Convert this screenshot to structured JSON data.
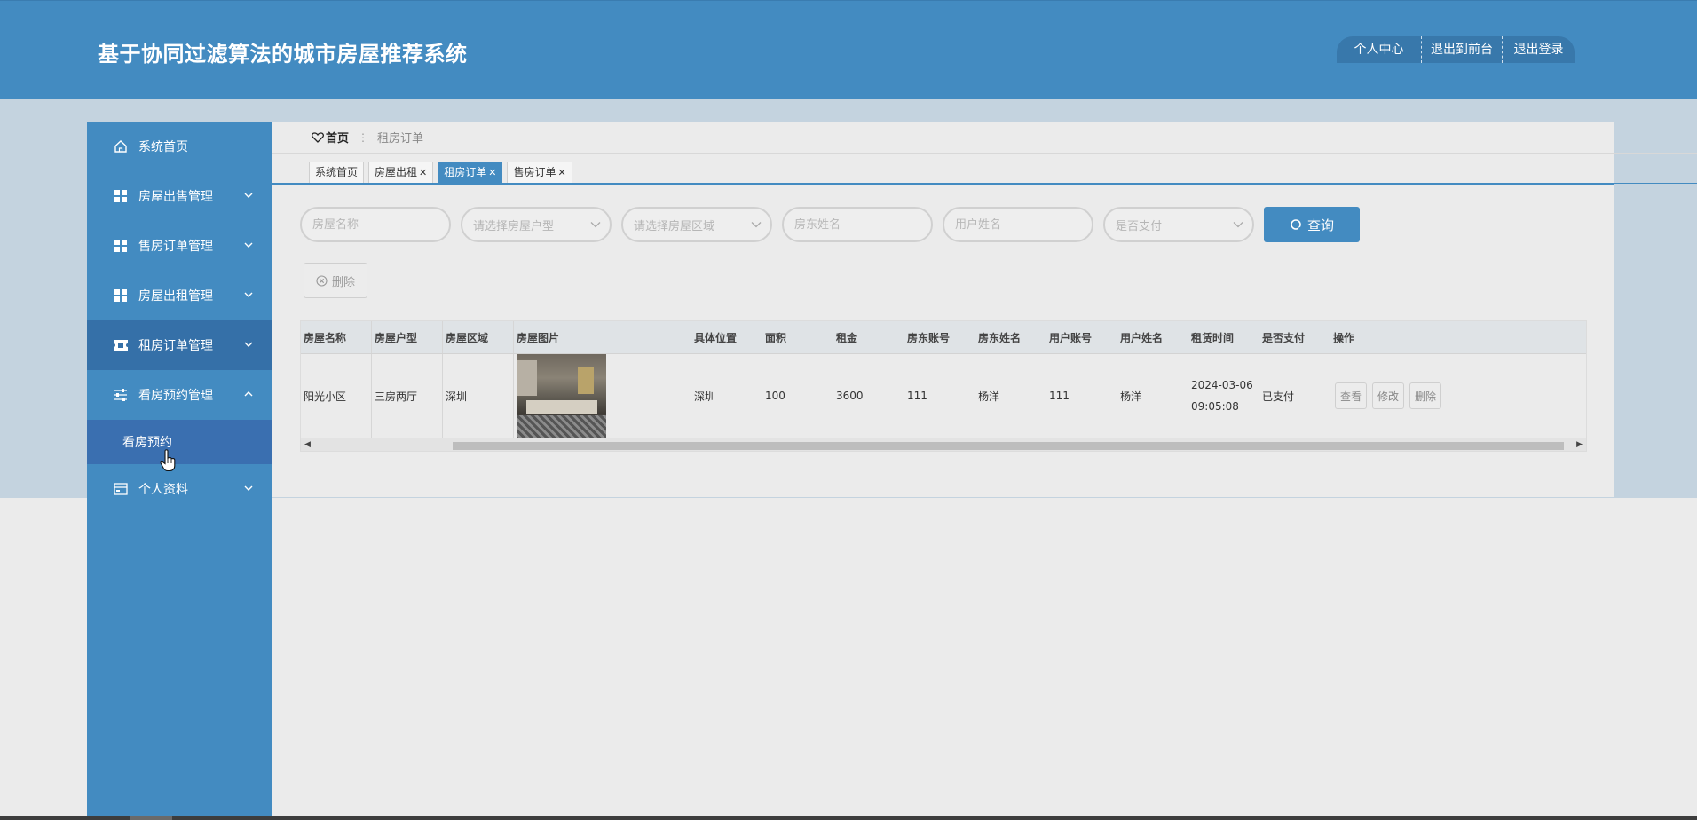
{
  "header": {
    "title": "基于协同过滤算法的城市房屋推荐系统",
    "menu": [
      "个人中心",
      "退出到前台",
      "退出登录"
    ]
  },
  "sidebar": {
    "items": [
      {
        "label": "系统首页",
        "icon": "home-icon"
      },
      {
        "label": "房屋出售管理",
        "icon": "grid-icon"
      },
      {
        "label": "售房订单管理",
        "icon": "grid-icon"
      },
      {
        "label": "房屋出租管理",
        "icon": "grid-icon"
      },
      {
        "label": "租房订单管理",
        "icon": "ticket-icon"
      },
      {
        "label": "看房预约管理",
        "icon": "sliders-icon"
      },
      {
        "label": "个人资料",
        "icon": "card-icon"
      }
    ],
    "subitem": "看房预约"
  },
  "breadcrumb": {
    "home": "首页",
    "separator": "⋮",
    "current": "租房订单"
  },
  "tabs": [
    {
      "label": "系统首页",
      "closable": false
    },
    {
      "label": "房屋出租",
      "closable": true
    },
    {
      "label": "租房订单",
      "closable": true,
      "active": true
    },
    {
      "label": "售房订单",
      "closable": true
    }
  ],
  "filters": {
    "house_name": "房屋名称",
    "house_type": "请选择房屋户型",
    "house_area": "请选择房屋区域",
    "landlord_name": "房东姓名",
    "user_name": "用户姓名",
    "paid": "是否支付",
    "search_label": "查询"
  },
  "delete_label": "删除",
  "table": {
    "columns": [
      "房屋名称",
      "房屋户型",
      "房屋区域",
      "房屋图片",
      "具体位置",
      "面积",
      "租金",
      "房东账号",
      "房东姓名",
      "用户账号",
      "用户姓名",
      "租赁时间",
      "是否支付",
      "操作"
    ],
    "rows": [
      {
        "name": "阳光小区",
        "type": "三房两厅",
        "area": "深圳",
        "location": "深圳",
        "size": "100",
        "rent": "3600",
        "landlord_account": "111",
        "landlord_name": "杨洋",
        "user_account": "111",
        "user_name": "杨洋",
        "date": "2024-03-06",
        "time": "09:05:08",
        "paid": "已支付",
        "actions": [
          "查看",
          "修改",
          "删除"
        ]
      }
    ]
  },
  "colors": {
    "primary": "#438bc1",
    "sidebar_active": "#3570a8",
    "band": "#c4d3df"
  }
}
